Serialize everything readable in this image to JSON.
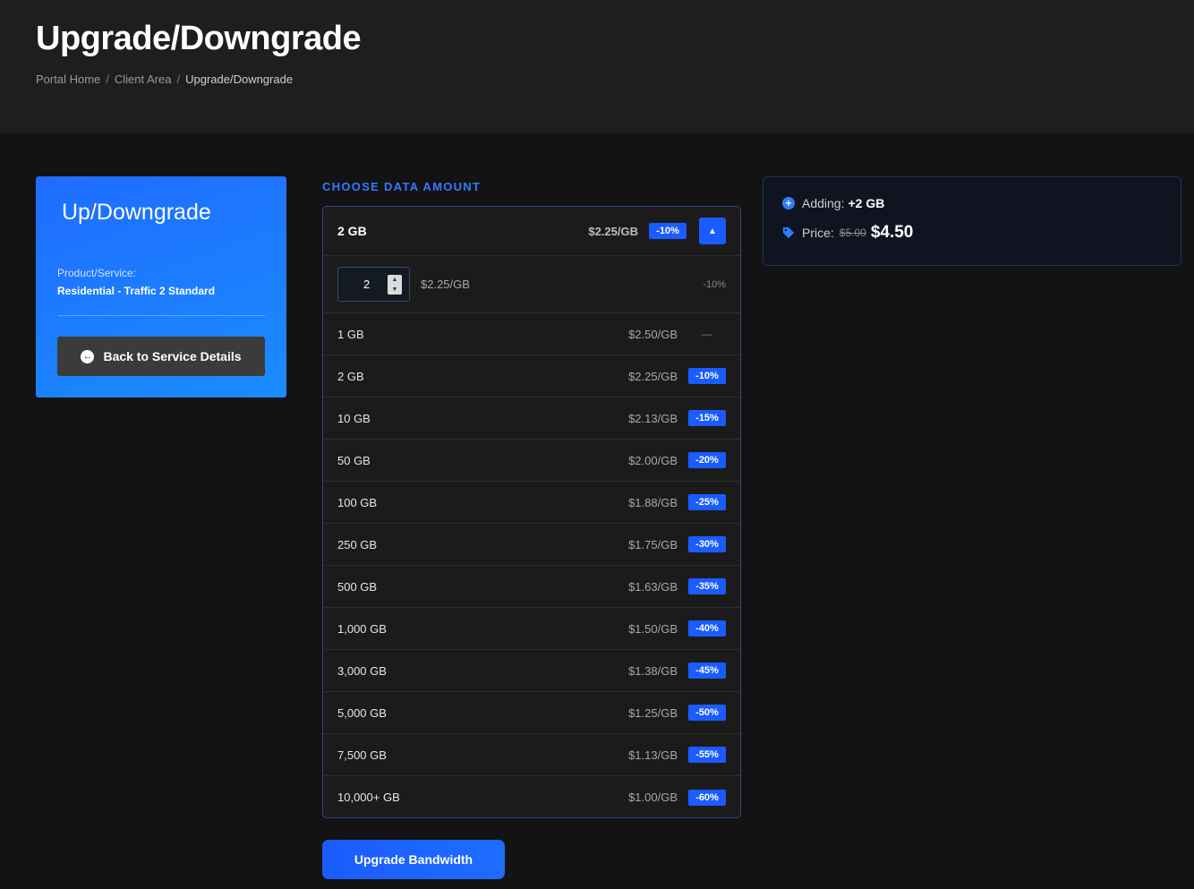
{
  "header": {
    "title": "Upgrade/Downgrade",
    "breadcrumb": [
      "Portal Home",
      "Client Area",
      "Upgrade/Downgrade"
    ]
  },
  "sidebar": {
    "title": "Up/Downgrade",
    "product_label": "Product/Service:",
    "product_value": "Residential - Traffic 2 Standard",
    "back_button": "Back to Service Details"
  },
  "main": {
    "section_label": "CHOOSE DATA AMOUNT",
    "selected": {
      "amount": "2 GB",
      "price": "$2.25/GB",
      "discount": "-10%"
    },
    "custom": {
      "quantity": "2",
      "price": "$2.25/GB",
      "discount": "-10%"
    },
    "options": [
      {
        "amount": "1 GB",
        "price": "$2.50/GB",
        "discount": "—"
      },
      {
        "amount": "2 GB",
        "price": "$2.25/GB",
        "discount": "-10%"
      },
      {
        "amount": "10 GB",
        "price": "$2.13/GB",
        "discount": "-15%"
      },
      {
        "amount": "50 GB",
        "price": "$2.00/GB",
        "discount": "-20%"
      },
      {
        "amount": "100 GB",
        "price": "$1.88/GB",
        "discount": "-25%"
      },
      {
        "amount": "250 GB",
        "price": "$1.75/GB",
        "discount": "-30%"
      },
      {
        "amount": "500 GB",
        "price": "$1.63/GB",
        "discount": "-35%"
      },
      {
        "amount": "1,000 GB",
        "price": "$1.50/GB",
        "discount": "-40%"
      },
      {
        "amount": "3,000 GB",
        "price": "$1.38/GB",
        "discount": "-45%"
      },
      {
        "amount": "5,000 GB",
        "price": "$1.25/GB",
        "discount": "-50%"
      },
      {
        "amount": "7,500 GB",
        "price": "$1.13/GB",
        "discount": "-55%"
      },
      {
        "amount": "10,000+ GB",
        "price": "$1.00/GB",
        "discount": "-60%"
      }
    ],
    "upgrade_button": "Upgrade Bandwidth"
  },
  "summary": {
    "adding_label": "Adding:",
    "adding_value": "+2 GB",
    "price_label": "Price:",
    "old_price": "$5.00",
    "new_price": "$4.50"
  },
  "colors": {
    "accent": "#1a5cff",
    "page_bg": "#131313",
    "header_bg": "#1e1e1e"
  }
}
